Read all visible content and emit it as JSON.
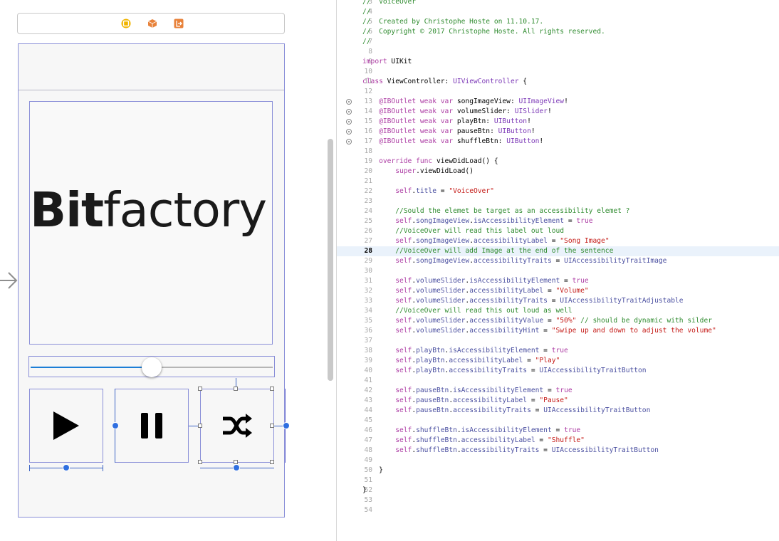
{
  "storyboard": {
    "dock_icons": [
      {
        "name": "view-controller-icon",
        "color": "#e8a400"
      },
      {
        "name": "first-responder-icon",
        "color": "#e8823a"
      },
      {
        "name": "exit-icon",
        "color": "#e8823a"
      }
    ],
    "logo_text_bold": "Bit",
    "logo_text_regular": "factory",
    "slider_value_percent": 50,
    "buttons": [
      {
        "name": "play",
        "icon": "play-icon"
      },
      {
        "name": "pause",
        "icon": "pause-icon"
      },
      {
        "name": "shuffle",
        "icon": "shuffle-icon"
      }
    ],
    "accent_color": "#1c7ed6"
  },
  "editor": {
    "current_line": 28,
    "lines": [
      {
        "n": "3",
        "t": [
          [
            "cm",
            "//  VoiceOver"
          ]
        ]
      },
      {
        "n": "4",
        "t": [
          [
            "cm",
            "//"
          ]
        ]
      },
      {
        "n": "5",
        "t": [
          [
            "cm",
            "//  Created by Christophe Hoste on 11.10.17."
          ]
        ]
      },
      {
        "n": "6",
        "t": [
          [
            "cm",
            "//  Copyright © 2017 Christophe Hoste. All rights reserved."
          ]
        ]
      },
      {
        "n": "7",
        "t": [
          [
            "cm",
            "//"
          ]
        ]
      },
      {
        "n": "8",
        "t": []
      },
      {
        "n": "9",
        "t": [
          [
            "kw",
            "import"
          ],
          [
            "pl",
            " UIKit"
          ]
        ]
      },
      {
        "n": "10",
        "t": []
      },
      {
        "n": "11",
        "t": [
          [
            "kw",
            "class"
          ],
          [
            "pl",
            " ViewController: "
          ],
          [
            "ty",
            "UIViewController"
          ],
          [
            "pl",
            " {"
          ]
        ]
      },
      {
        "n": "12",
        "t": []
      },
      {
        "n": "13",
        "bp": true,
        "t": [
          [
            "pl",
            "    "
          ],
          [
            "at",
            "@IBOutlet"
          ],
          [
            "pl",
            " "
          ],
          [
            "kw",
            "weak"
          ],
          [
            "pl",
            " "
          ],
          [
            "kw",
            "var"
          ],
          [
            "pl",
            " songImageView: "
          ],
          [
            "ty",
            "UIImageView"
          ],
          [
            "pl",
            "!"
          ]
        ]
      },
      {
        "n": "14",
        "bp": true,
        "t": [
          [
            "pl",
            "    "
          ],
          [
            "at",
            "@IBOutlet"
          ],
          [
            "pl",
            " "
          ],
          [
            "kw",
            "weak"
          ],
          [
            "pl",
            " "
          ],
          [
            "kw",
            "var"
          ],
          [
            "pl",
            " volumeSlider: "
          ],
          [
            "ty",
            "UISlider"
          ],
          [
            "pl",
            "!"
          ]
        ]
      },
      {
        "n": "15",
        "bp": true,
        "t": [
          [
            "pl",
            "    "
          ],
          [
            "at",
            "@IBOutlet"
          ],
          [
            "pl",
            " "
          ],
          [
            "kw",
            "weak"
          ],
          [
            "pl",
            " "
          ],
          [
            "kw",
            "var"
          ],
          [
            "pl",
            " playBtn: "
          ],
          [
            "ty",
            "UIButton"
          ],
          [
            "pl",
            "!"
          ]
        ]
      },
      {
        "n": "16",
        "bp": true,
        "t": [
          [
            "pl",
            "    "
          ],
          [
            "at",
            "@IBOutlet"
          ],
          [
            "pl",
            " "
          ],
          [
            "kw",
            "weak"
          ],
          [
            "pl",
            " "
          ],
          [
            "kw",
            "var"
          ],
          [
            "pl",
            " pauseBtn: "
          ],
          [
            "ty",
            "UIButton"
          ],
          [
            "pl",
            "!"
          ]
        ]
      },
      {
        "n": "17",
        "bp": true,
        "t": [
          [
            "pl",
            "    "
          ],
          [
            "at",
            "@IBOutlet"
          ],
          [
            "pl",
            " "
          ],
          [
            "kw",
            "weak"
          ],
          [
            "pl",
            " "
          ],
          [
            "kw",
            "var"
          ],
          [
            "pl",
            " shuffleBtn: "
          ],
          [
            "ty",
            "UIButton"
          ],
          [
            "pl",
            "!"
          ]
        ]
      },
      {
        "n": "18",
        "t": []
      },
      {
        "n": "19",
        "t": [
          [
            "pl",
            "    "
          ],
          [
            "kw",
            "override"
          ],
          [
            "pl",
            " "
          ],
          [
            "kw",
            "func"
          ],
          [
            "pl",
            " viewDidLoad() {"
          ]
        ]
      },
      {
        "n": "20",
        "t": [
          [
            "pl",
            "        "
          ],
          [
            "kw",
            "super"
          ],
          [
            "pl",
            ".viewDidLoad()"
          ]
        ]
      },
      {
        "n": "21",
        "t": []
      },
      {
        "n": "22",
        "t": [
          [
            "pl",
            "        "
          ],
          [
            "kw",
            "self"
          ],
          [
            "pl",
            "."
          ],
          [
            "pr",
            "title"
          ],
          [
            "pl",
            " = "
          ],
          [
            "st",
            "\"VoiceOver\""
          ]
        ]
      },
      {
        "n": "23",
        "t": []
      },
      {
        "n": "24",
        "t": [
          [
            "pl",
            "        "
          ],
          [
            "cm",
            "//Sould the elemet be target as an accessibility elemet ?"
          ]
        ]
      },
      {
        "n": "25",
        "t": [
          [
            "pl",
            "        "
          ],
          [
            "kw",
            "self"
          ],
          [
            "pl",
            "."
          ],
          [
            "pr",
            "songImageView"
          ],
          [
            "pl",
            "."
          ],
          [
            "pr",
            "isAccessibilityElement"
          ],
          [
            "pl",
            " = "
          ],
          [
            "kw",
            "true"
          ]
        ]
      },
      {
        "n": "26",
        "t": [
          [
            "pl",
            "        "
          ],
          [
            "cm",
            "//VoiceOver will read this label out loud"
          ]
        ]
      },
      {
        "n": "27",
        "t": [
          [
            "pl",
            "        "
          ],
          [
            "kw",
            "self"
          ],
          [
            "pl",
            "."
          ],
          [
            "pr",
            "songImageView"
          ],
          [
            "pl",
            "."
          ],
          [
            "pr",
            "accessibilityLabel"
          ],
          [
            "pl",
            " = "
          ],
          [
            "st",
            "\"Song Image\""
          ]
        ]
      },
      {
        "n": "28",
        "t": [
          [
            "pl",
            "        "
          ],
          [
            "cm",
            "//VoiceOver will add Image at the end of the sentence"
          ]
        ]
      },
      {
        "n": "29",
        "t": [
          [
            "pl",
            "        "
          ],
          [
            "kw",
            "self"
          ],
          [
            "pl",
            "."
          ],
          [
            "pr",
            "songImageView"
          ],
          [
            "pl",
            "."
          ],
          [
            "pr",
            "accessibilityTraits"
          ],
          [
            "pl",
            " = "
          ],
          [
            "pr",
            "UIAccessibilityTraitImage"
          ]
        ]
      },
      {
        "n": "30",
        "t": []
      },
      {
        "n": "31",
        "t": [
          [
            "pl",
            "        "
          ],
          [
            "kw",
            "self"
          ],
          [
            "pl",
            "."
          ],
          [
            "pr",
            "volumeSlider"
          ],
          [
            "pl",
            "."
          ],
          [
            "pr",
            "isAccessibilityElement"
          ],
          [
            "pl",
            " = "
          ],
          [
            "kw",
            "true"
          ]
        ]
      },
      {
        "n": "32",
        "t": [
          [
            "pl",
            "        "
          ],
          [
            "kw",
            "self"
          ],
          [
            "pl",
            "."
          ],
          [
            "pr",
            "volumeSlider"
          ],
          [
            "pl",
            "."
          ],
          [
            "pr",
            "accessibilityLabel"
          ],
          [
            "pl",
            " = "
          ],
          [
            "st",
            "\"Volume\""
          ]
        ]
      },
      {
        "n": "33",
        "t": [
          [
            "pl",
            "        "
          ],
          [
            "kw",
            "self"
          ],
          [
            "pl",
            "."
          ],
          [
            "pr",
            "volumeSlider"
          ],
          [
            "pl",
            "."
          ],
          [
            "pr",
            "accessibilityTraits"
          ],
          [
            "pl",
            " = "
          ],
          [
            "pr",
            "UIAccessibilityTraitAdjustable"
          ]
        ]
      },
      {
        "n": "34",
        "t": [
          [
            "pl",
            "        "
          ],
          [
            "cm",
            "//VoiceOver will read this out loud as well"
          ]
        ]
      },
      {
        "n": "35",
        "t": [
          [
            "pl",
            "        "
          ],
          [
            "kw",
            "self"
          ],
          [
            "pl",
            "."
          ],
          [
            "pr",
            "volumeSlider"
          ],
          [
            "pl",
            "."
          ],
          [
            "pr",
            "accessibilityValue"
          ],
          [
            "pl",
            " = "
          ],
          [
            "st",
            "\"50%\""
          ],
          [
            "pl",
            " "
          ],
          [
            "cm",
            "// should be dynamic with silder"
          ]
        ]
      },
      {
        "n": "36",
        "t": [
          [
            "pl",
            "        "
          ],
          [
            "kw",
            "self"
          ],
          [
            "pl",
            "."
          ],
          [
            "pr",
            "volumeSlider"
          ],
          [
            "pl",
            "."
          ],
          [
            "pr",
            "accessibilityHint"
          ],
          [
            "pl",
            " = "
          ],
          [
            "st",
            "\"Swipe up and down to adjust the volume\""
          ]
        ]
      },
      {
        "n": "37",
        "t": []
      },
      {
        "n": "38",
        "t": [
          [
            "pl",
            "        "
          ],
          [
            "kw",
            "self"
          ],
          [
            "pl",
            "."
          ],
          [
            "pr",
            "playBtn"
          ],
          [
            "pl",
            "."
          ],
          [
            "pr",
            "isAccessibilityElement"
          ],
          [
            "pl",
            " = "
          ],
          [
            "kw",
            "true"
          ]
        ]
      },
      {
        "n": "39",
        "t": [
          [
            "pl",
            "        "
          ],
          [
            "kw",
            "self"
          ],
          [
            "pl",
            "."
          ],
          [
            "pr",
            "playBtn"
          ],
          [
            "pl",
            "."
          ],
          [
            "pr",
            "accessibilityLabel"
          ],
          [
            "pl",
            " = "
          ],
          [
            "st",
            "\"Play\""
          ]
        ]
      },
      {
        "n": "40",
        "t": [
          [
            "pl",
            "        "
          ],
          [
            "kw",
            "self"
          ],
          [
            "pl",
            "."
          ],
          [
            "pr",
            "playBtn"
          ],
          [
            "pl",
            "."
          ],
          [
            "pr",
            "accessibilityTraits"
          ],
          [
            "pl",
            " = "
          ],
          [
            "pr",
            "UIAccessibilityTraitButton"
          ]
        ]
      },
      {
        "n": "41",
        "t": []
      },
      {
        "n": "42",
        "t": [
          [
            "pl",
            "        "
          ],
          [
            "kw",
            "self"
          ],
          [
            "pl",
            "."
          ],
          [
            "pr",
            "pauseBtn"
          ],
          [
            "pl",
            "."
          ],
          [
            "pr",
            "isAccessibilityElement"
          ],
          [
            "pl",
            " = "
          ],
          [
            "kw",
            "true"
          ]
        ]
      },
      {
        "n": "43",
        "t": [
          [
            "pl",
            "        "
          ],
          [
            "kw",
            "self"
          ],
          [
            "pl",
            "."
          ],
          [
            "pr",
            "pauseBtn"
          ],
          [
            "pl",
            "."
          ],
          [
            "pr",
            "accessibilityLabel"
          ],
          [
            "pl",
            " = "
          ],
          [
            "st",
            "\"Pause\""
          ]
        ]
      },
      {
        "n": "44",
        "t": [
          [
            "pl",
            "        "
          ],
          [
            "kw",
            "self"
          ],
          [
            "pl",
            "."
          ],
          [
            "pr",
            "pauseBtn"
          ],
          [
            "pl",
            "."
          ],
          [
            "pr",
            "accessibilityTraits"
          ],
          [
            "pl",
            " = "
          ],
          [
            "pr",
            "UIAccessibilityTraitButton"
          ]
        ]
      },
      {
        "n": "45",
        "t": []
      },
      {
        "n": "46",
        "t": [
          [
            "pl",
            "        "
          ],
          [
            "kw",
            "self"
          ],
          [
            "pl",
            "."
          ],
          [
            "pr",
            "shuffleBtn"
          ],
          [
            "pl",
            "."
          ],
          [
            "pr",
            "isAccessibilityElement"
          ],
          [
            "pl",
            " = "
          ],
          [
            "kw",
            "true"
          ]
        ]
      },
      {
        "n": "47",
        "t": [
          [
            "pl",
            "        "
          ],
          [
            "kw",
            "self"
          ],
          [
            "pl",
            "."
          ],
          [
            "pr",
            "shuffleBtn"
          ],
          [
            "pl",
            "."
          ],
          [
            "pr",
            "accessibilityLabel"
          ],
          [
            "pl",
            " = "
          ],
          [
            "st",
            "\"Shuffle\""
          ]
        ]
      },
      {
        "n": "48",
        "t": [
          [
            "pl",
            "        "
          ],
          [
            "kw",
            "self"
          ],
          [
            "pl",
            "."
          ],
          [
            "pr",
            "shuffleBtn"
          ],
          [
            "pl",
            "."
          ],
          [
            "pr",
            "accessibilityTraits"
          ],
          [
            "pl",
            " = "
          ],
          [
            "pr",
            "UIAccessibilityTraitButton"
          ]
        ]
      },
      {
        "n": "49",
        "t": []
      },
      {
        "n": "50",
        "t": [
          [
            "pl",
            "    }"
          ]
        ]
      },
      {
        "n": "51",
        "t": []
      },
      {
        "n": "52",
        "t": [
          [
            "pl",
            "}"
          ]
        ]
      },
      {
        "n": "53",
        "t": []
      },
      {
        "n": "54",
        "t": []
      }
    ]
  }
}
